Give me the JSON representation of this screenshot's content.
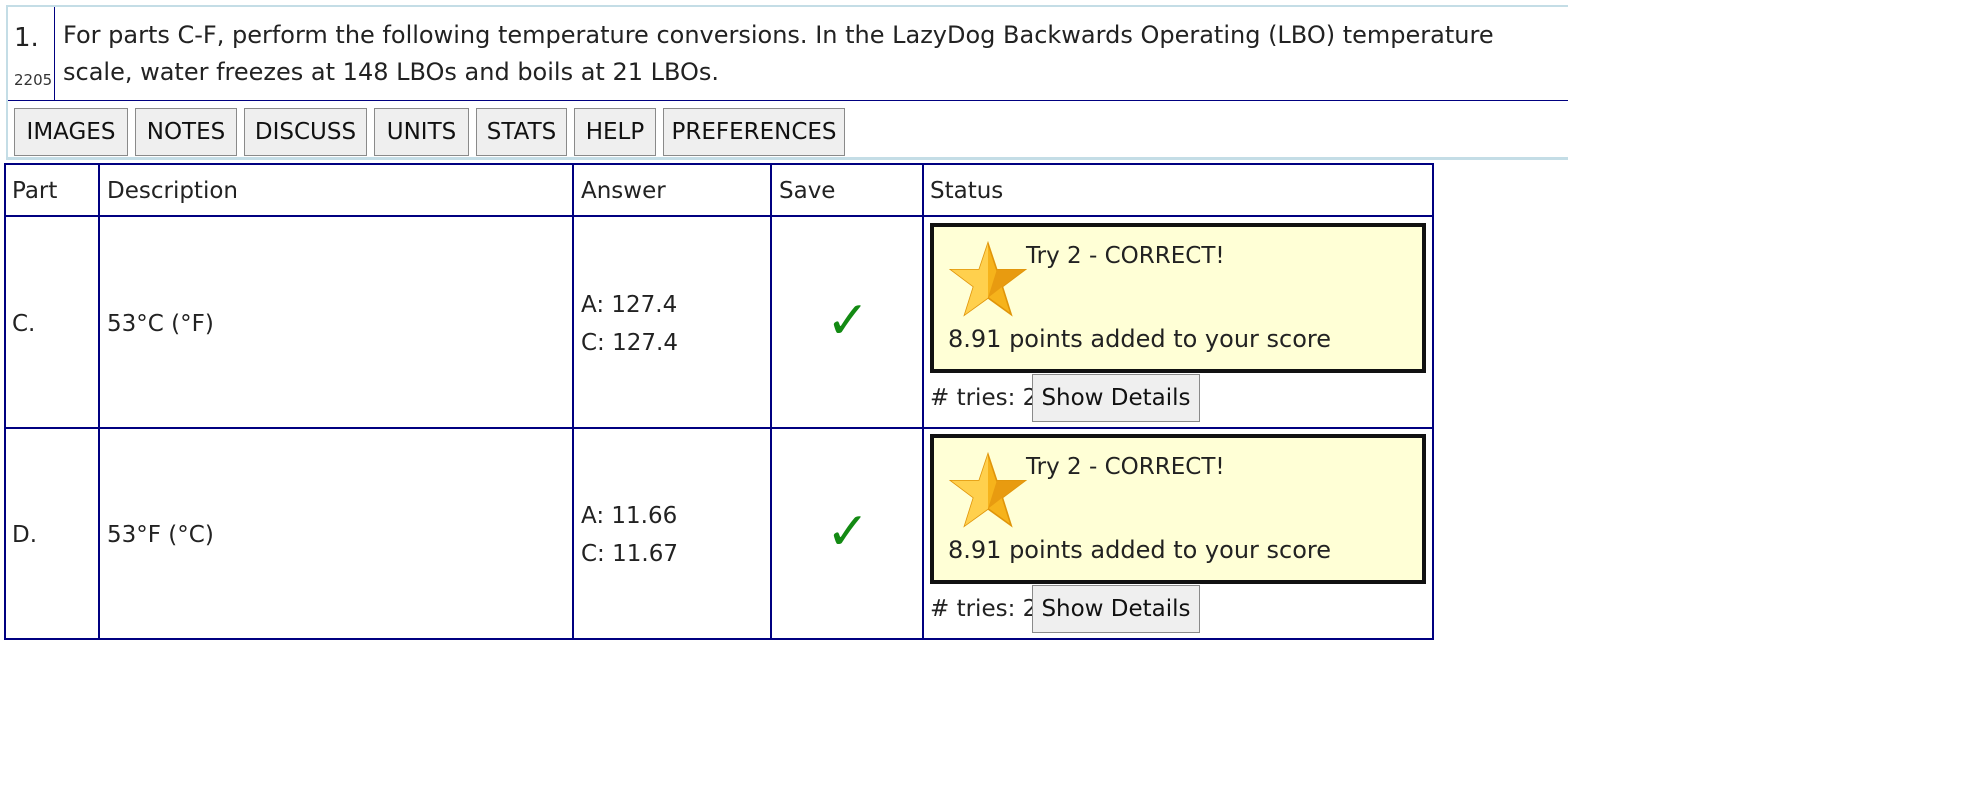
{
  "problem": {
    "number": "1.",
    "id": "2205",
    "text": "For parts C-F, perform the following temperature conversions. In the LazyDog Backwards Operating (LBO) temperature scale, water freezes at 148 LBOs and boils at 21 LBOs."
  },
  "toolbar": {
    "images": "IMAGES",
    "notes": "NOTES",
    "discuss": "DISCUSS",
    "units": "UNITS",
    "stats": "STATS",
    "help": "HELP",
    "preferences": "PREFERENCES"
  },
  "table": {
    "headers": {
      "part": "Part",
      "description": "Description",
      "answer": "Answer",
      "save": "Save",
      "status": "Status"
    },
    "rows": [
      {
        "part": "C.",
        "description": "53°C (°F)",
        "answer_a": "A: 127.4",
        "answer_c": "C: 127.4",
        "saved_mark": "✓",
        "status_title": "Try 2 - CORRECT!",
        "status_points": "8.91 points added to your score",
        "tries": "# tries: 2",
        "details_label": "Show Details"
      },
      {
        "part": "D.",
        "description": "53°F (°C)",
        "answer_a": "A: 11.66",
        "answer_c": "C: 11.67",
        "saved_mark": "✓",
        "status_title": "Try 2 - CORRECT!",
        "status_points": "8.91 points added to your score",
        "tries": "# tries: 2",
        "details_label": "Show Details"
      }
    ]
  },
  "icons": {
    "star": "star-icon",
    "check": "checkmark-icon"
  },
  "colors": {
    "accent": "#000080",
    "status_bg": "#ffffd6",
    "check": "#138a13",
    "star": "#f6b31b"
  }
}
